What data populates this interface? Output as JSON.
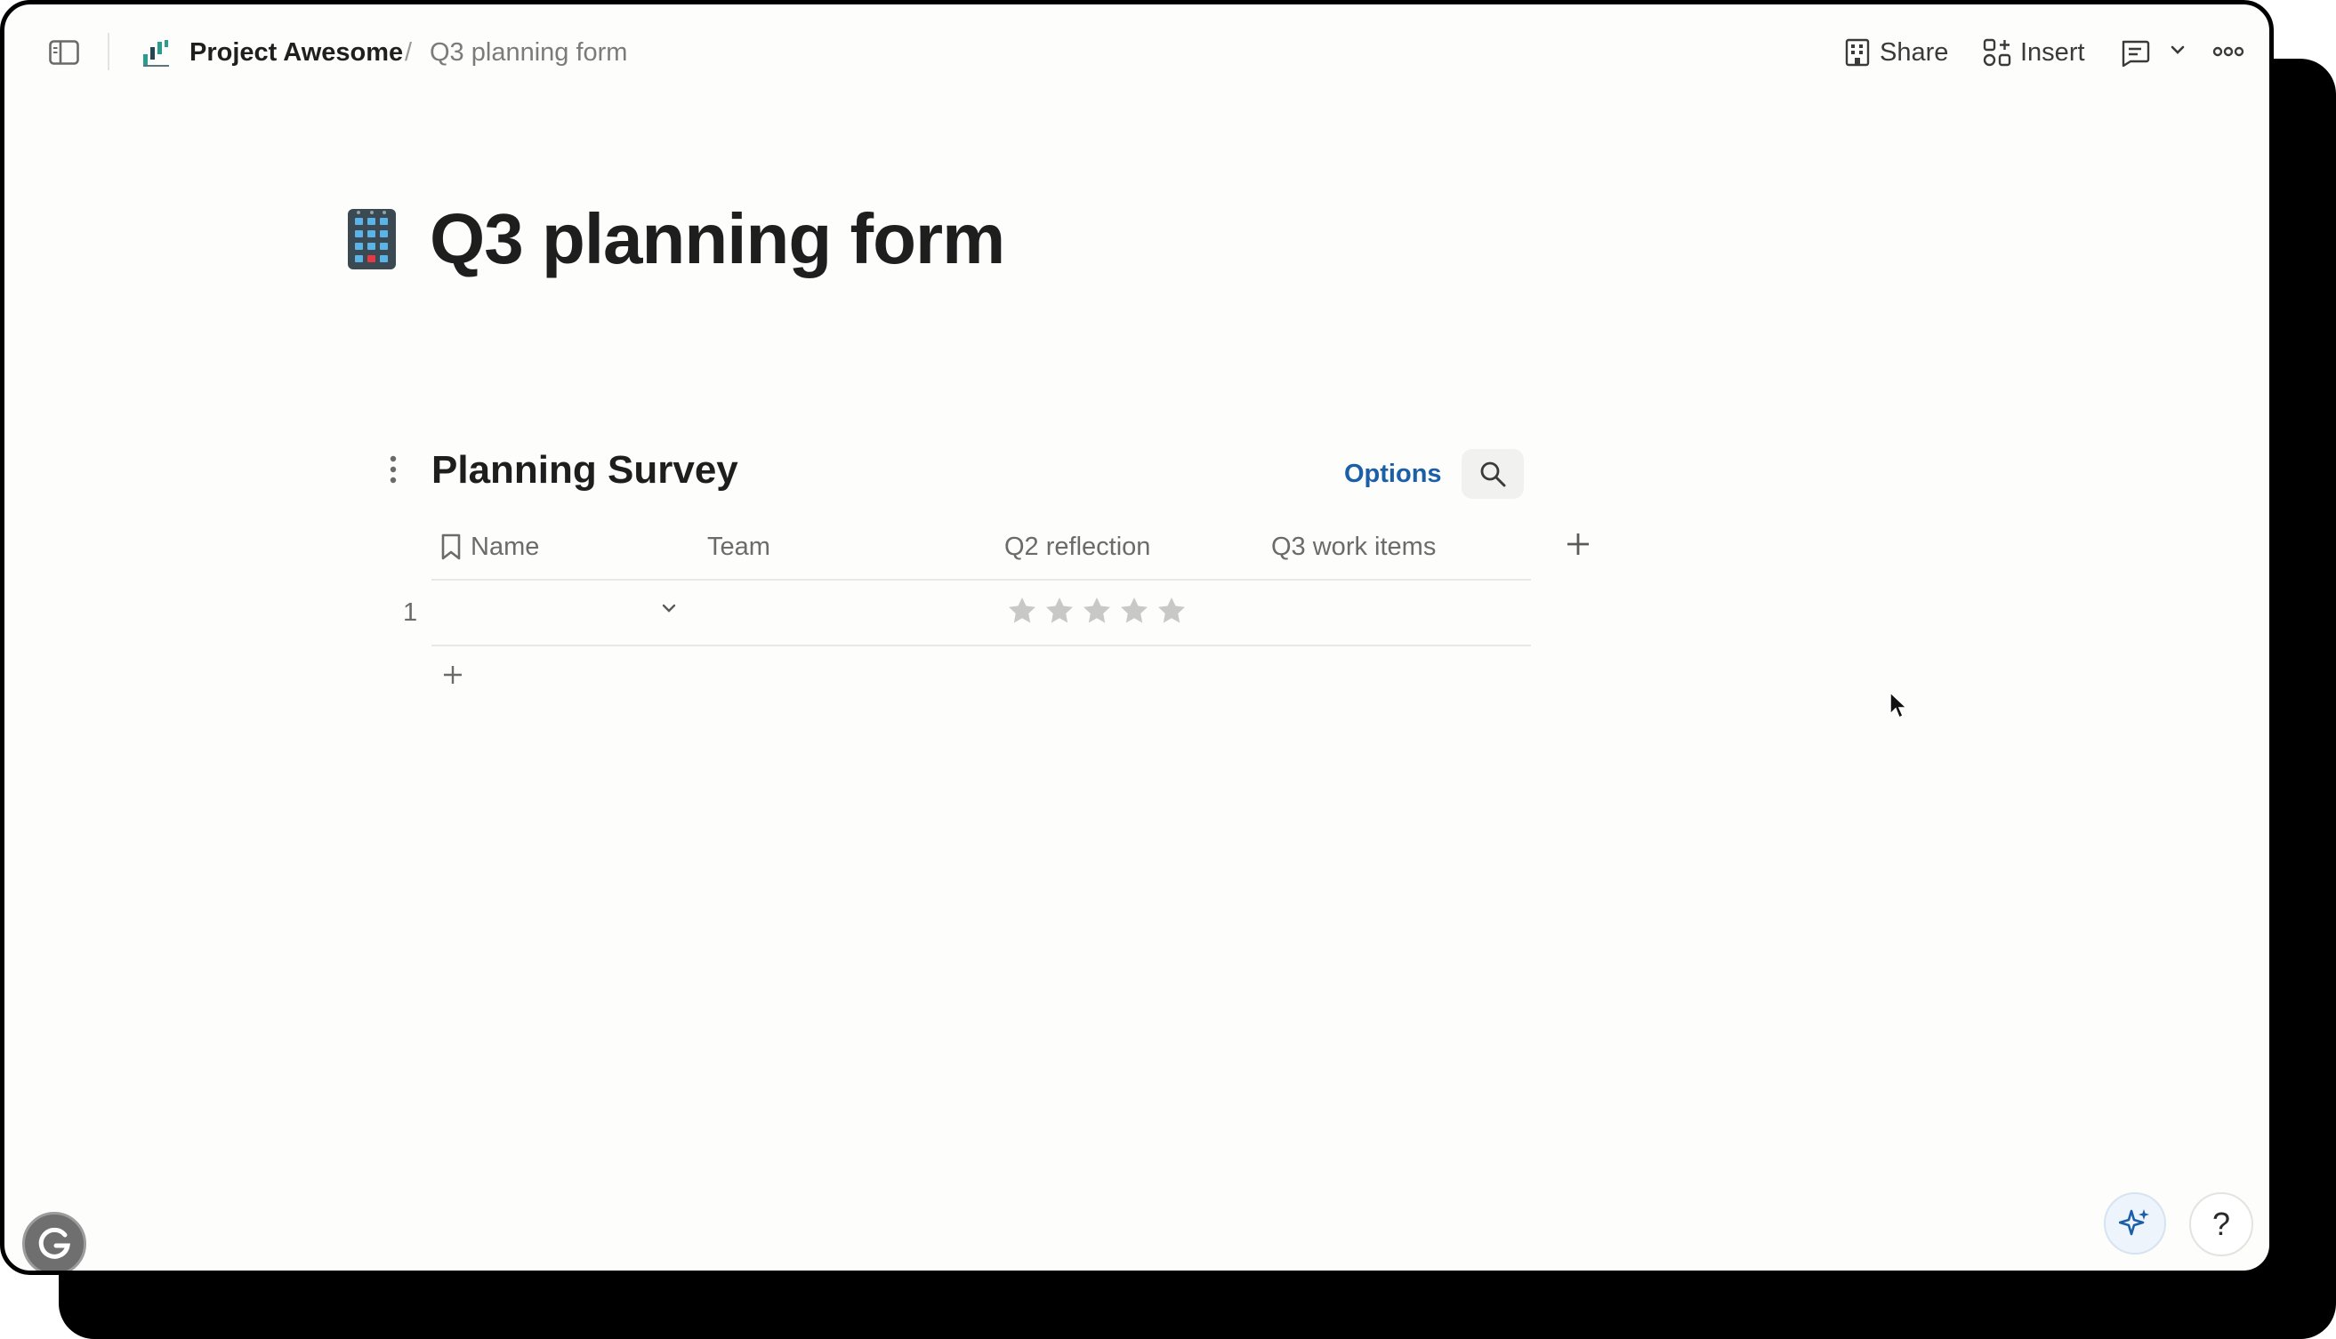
{
  "breadcrumb": {
    "project": "Project Awesome",
    "separator": "/",
    "page": "Q3 planning form"
  },
  "toolbar": {
    "share_label": "Share",
    "insert_label": "Insert"
  },
  "page": {
    "title": "Q3 planning form",
    "icon": "abacus-icon"
  },
  "survey": {
    "title": "Planning Survey",
    "options_label": "Options",
    "columns": [
      {
        "label": "Name",
        "icon": "bookmark-icon"
      },
      {
        "label": "Team"
      },
      {
        "label": "Q2 reflection"
      },
      {
        "label": "Q3 work items"
      }
    ],
    "rows": [
      {
        "number": "1",
        "name": "",
        "team": "",
        "q2_reflection_rating": 0,
        "q3_work_items": ""
      }
    ],
    "rating_max": 5
  },
  "help_label": "?",
  "colors": {
    "accent": "#1b5fa8",
    "title": "#1e1e1e",
    "muted": "#6b6b68",
    "star_empty": "#c8c8c6"
  }
}
